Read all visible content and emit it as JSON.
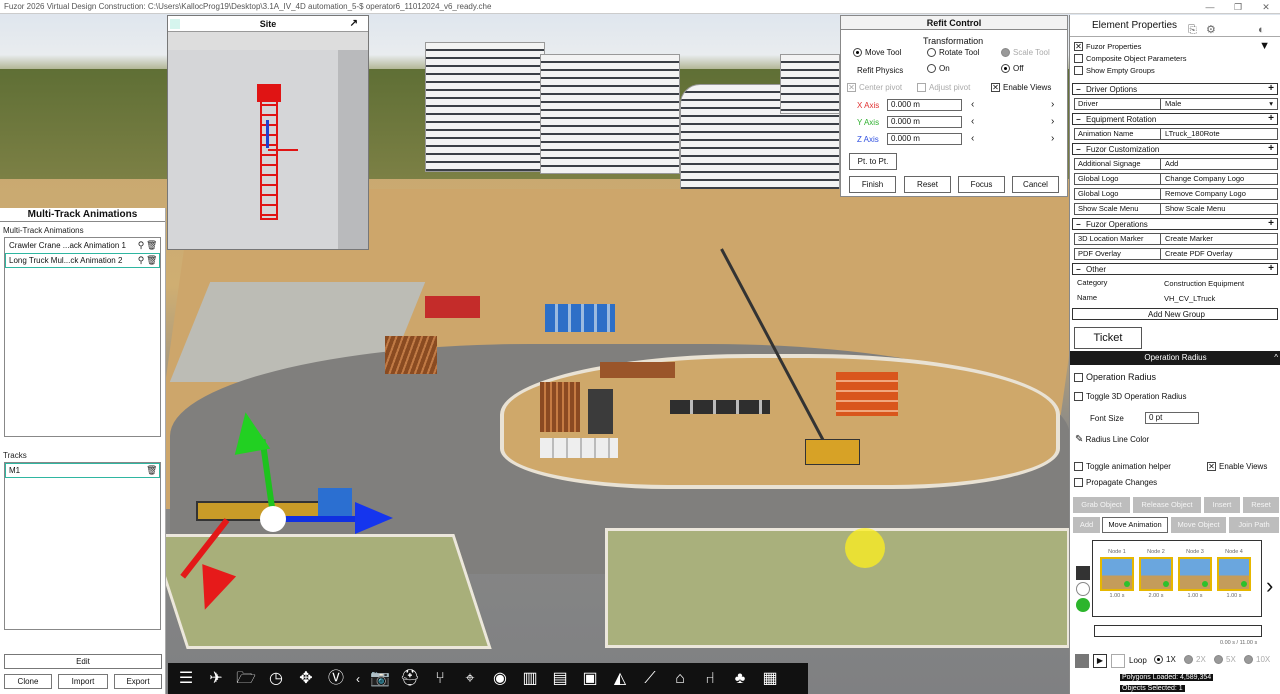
{
  "window": {
    "title": "Fuzor 2026 Virtual Design Construction: C:\\Users\\KallocProg19\\Desktop\\3.1A_IV_4D automation_5-$ operator6_11012024_v6_ready.che",
    "controls": [
      "—",
      "❐",
      "✕"
    ]
  },
  "site": {
    "title": "Site",
    "popout": "↗"
  },
  "multitrack": {
    "title": "Multi-Track Animations",
    "section_label": "Multi-Track Animations",
    "items": [
      {
        "label": "Crawler Crane ...ack Animation 1"
      },
      {
        "label": "Long Truck Mul...ck Animation 2"
      }
    ],
    "tracks_label": "Tracks",
    "tracks": [
      {
        "label": "M1"
      }
    ],
    "edit_label": "Edit",
    "clone_label": "Clone",
    "import_label": "Import",
    "export_label": "Export"
  },
  "refit": {
    "title": "Refit Control",
    "transformation_label": "Transformation",
    "move_tool": "Move Tool",
    "rotate_tool": "Rotate Tool",
    "scale_tool": "Scale Tool",
    "refit_physics": "Refit Physics",
    "on": "On",
    "off": "Off",
    "center_pivot": "Center pivot",
    "adjust_pivot": "Adjust pivot",
    "enable_views": "Enable Views",
    "x_axis": "X Axis",
    "y_axis": "Y Axis",
    "z_axis": "Z Axis",
    "x_value": "0.000 m",
    "y_value": "0.000 m",
    "z_value": "0.000 m",
    "pt_to_pt": "Pt. to Pt.",
    "finish": "Finish",
    "reset": "Reset",
    "focus": "Focus",
    "cancel": "Cancel",
    "colors": {
      "x": "#e03030",
      "y": "#30b030",
      "z": "#3050e0"
    }
  },
  "props": {
    "title": "Element Properties",
    "fuzor_properties": "Fuzor Properties",
    "composite": "Composite Object Parameters",
    "show_empty": "Show Empty Groups",
    "driver_options": "Driver Options",
    "driver_key": "Driver",
    "driver_val": "Male",
    "equipment_rotation": "Equipment Rotation",
    "anim_name_key": "Animation Name",
    "anim_name_val": "LTruck_180Rote",
    "fuzor_custom": "Fuzor Customization",
    "add_signage_key": "Additional Signage",
    "add_signage_val": "Add",
    "global_logo1_key": "Global Logo",
    "global_logo1_val": "Change Company Logo",
    "global_logo2_key": "Global Logo",
    "global_logo2_val": "Remove Company Logo",
    "scale_menu_key": "Show Scale Menu",
    "scale_menu_val": "Show Scale Menu",
    "fuzor_ops": "Fuzor Operations",
    "loc_marker_key": "3D Location Marker",
    "loc_marker_val": "Create Marker",
    "pdf_key": "PDF Overlay",
    "pdf_val": "Create PDF Overlay",
    "other": "Other",
    "category_key": "Category",
    "category_val": "Construction Equipment",
    "name_key": "Name",
    "name_val": "VH_CV_LTruck",
    "add_group": "Add New Group",
    "ticket": "Ticket",
    "op_radius_head": "Operation Radius",
    "op_radius": "Operation Radius",
    "toggle_3d": "Toggle 3D Operation Radius",
    "font_size": "Font Size",
    "font_size_val": "0 pt",
    "radius_color": "Radius Line Color",
    "toggle_helper": "Toggle animation helper",
    "enable_views": "Enable Views",
    "propagate": "Propagate Changes",
    "grab_object": "Grab Object",
    "release_object": "Release Object",
    "insert": "Insert",
    "reset": "Reset",
    "add": "Add",
    "move_animation": "Move Animation",
    "move_object": "Move Object",
    "join_path": "Join Path",
    "nodes": [
      {
        "label": "Node 1",
        "time": "1.00 s"
      },
      {
        "label": "Node 2",
        "time": "2.00 s"
      },
      {
        "label": "Node 3",
        "time": "1.00 s"
      },
      {
        "label": "Node 4",
        "time": "1.00 s"
      }
    ],
    "timeline_time": "0.00 s / 11.00 s",
    "loop": "Loop",
    "speeds": [
      "1X",
      "2X",
      "5X",
      "10X"
    ],
    "polygons": "Polygons Loaded: 4,589,354",
    "objects_selected": "Objects Selected: 1"
  },
  "toolbar": {
    "icons": [
      "menu-icon",
      "drone-icon",
      "folder-icon",
      "clock-icon",
      "move-icon",
      "vr-icon",
      "collapse-icon",
      "camera-icon",
      "helmet-icon",
      "network-icon",
      "gps-icon",
      "eye-icon",
      "building-icon",
      "clipboard-icon",
      "film-icon",
      "chart-icon",
      "path-icon",
      "map-icon",
      "hierarchy-icon",
      "tree-icon",
      "report-icon"
    ],
    "glyphs": [
      "☰",
      "✈",
      "🗁",
      "◷",
      "✥",
      "Ⓥ",
      "‹",
      "📷",
      "⛑",
      "⑂",
      "⌖",
      "◉",
      "▥",
      "▤",
      "▣",
      "◭",
      "⟋",
      "⌂",
      "⑁",
      "♣",
      "▦"
    ]
  }
}
